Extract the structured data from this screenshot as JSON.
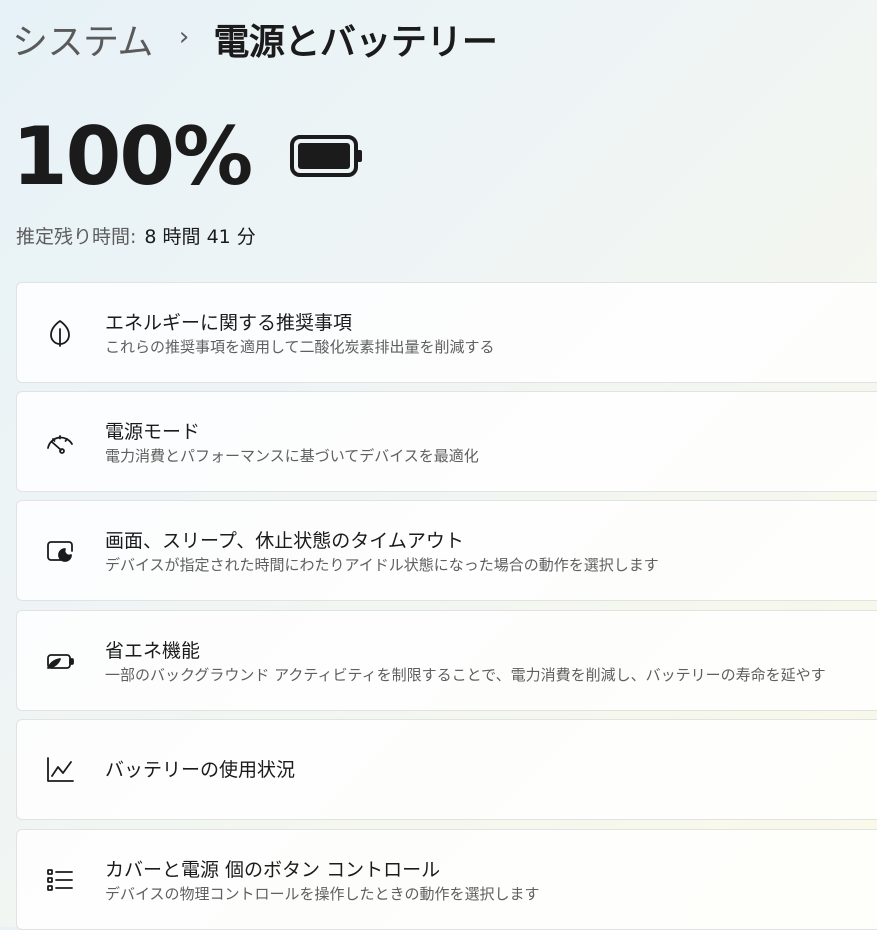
{
  "breadcrumb": {
    "parent": "システム",
    "separator": "›",
    "current": "電源とバッテリー"
  },
  "battery": {
    "percent_text": "100%",
    "charge_level": 1.0,
    "icon": "battery-full-icon",
    "estimate_label": "推定残り時間:",
    "estimate_value": "8 時間 41 分"
  },
  "settings": [
    {
      "icon": "leaf-icon",
      "title": "エネルギーに関する推奨事項",
      "description": "これらの推奨事項を適用して二酸化炭素排出量を削減する"
    },
    {
      "icon": "gauge-icon",
      "title": "電源モード",
      "description": "電力消費とパフォーマンスに基づいてデバイスを最適化"
    },
    {
      "icon": "screen-sleep-icon",
      "title": "画面、スリープ、休止状態のタイムアウト",
      "description": "デバイスが指定された時間にわたりアイドル状態になった場合の動作を選択します"
    },
    {
      "icon": "battery-saver-icon",
      "title": "省エネ機能",
      "description": "一部のバックグラウンド アクティビティを制限することで、電力消費を削減し、バッテリーの寿命を延やす"
    },
    {
      "icon": "line-chart-icon",
      "title": "バッテリーの使用状況",
      "description": ""
    },
    {
      "icon": "list-icon",
      "title": "カバーと電源 個のボタン コントロール",
      "description": "デバイスの物理コントロールを操作したときの動作を選択します"
    }
  ],
  "colors": {
    "text_primary": "#1b1b1b",
    "text_secondary": "#5f5f5f",
    "card_background": "#ffffff",
    "card_border": "#e0e3e2"
  }
}
